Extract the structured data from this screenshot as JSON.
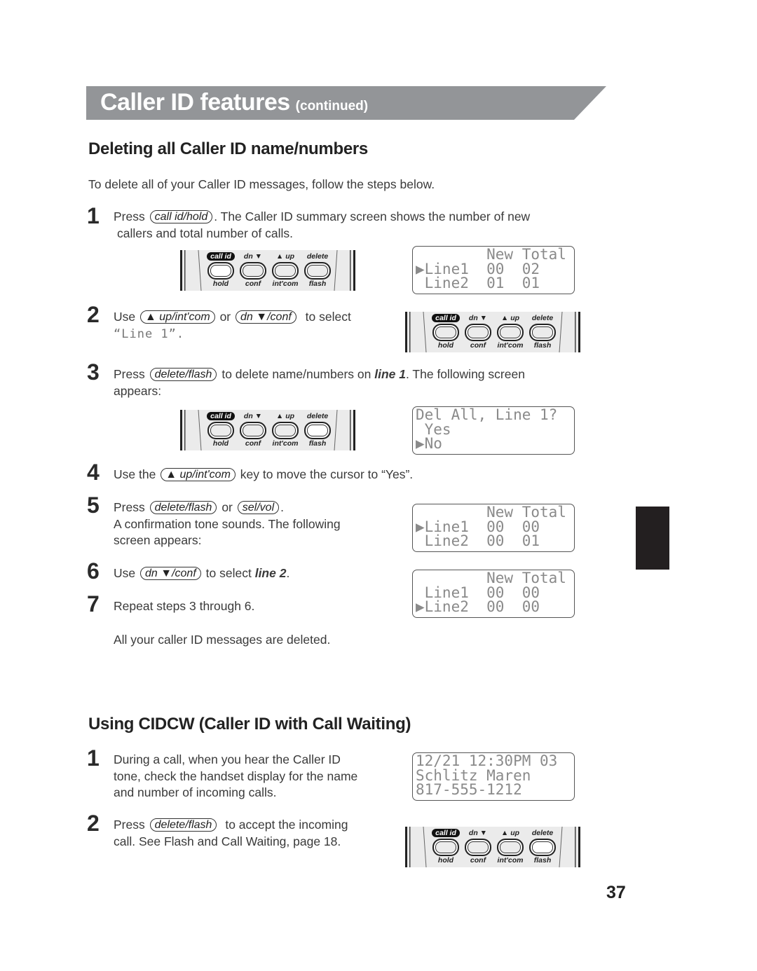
{
  "banner": {
    "title": "Caller ID features",
    "subtitle": "(continued)",
    "color": "#939598"
  },
  "section1": {
    "heading": "Deleting all Caller ID name/numbers",
    "intro": "To delete all of your Caller ID messages, follow the steps below.",
    "steps": [
      {
        "num": "1",
        "pre": "Press",
        "key1": "call id/hold",
        "post": ". The Caller ID summary screen shows the number of new",
        "line2": "callers and total number of calls."
      },
      {
        "num": "2",
        "pre": "Use",
        "key1": "▲ up/int'com",
        "mid": "or",
        "key2": "dn ▼/conf",
        "post": "to select",
        "line2_lcd": "“Line 1”."
      },
      {
        "num": "3",
        "pre": "Press",
        "key1": "delete/flash",
        "post_a": "to delete name/numbers on",
        "post_bold": "line 1",
        "post_b": ". The following screen",
        "line2": "appears:"
      },
      {
        "num": "4",
        "pre": "Use the",
        "key1": "▲ up/int'com",
        "post": "key to move the cursor to “Yes”."
      },
      {
        "num": "5",
        "pre": "Press",
        "key1": "delete/flash",
        "mid": "or",
        "key2": "sel/vol",
        "post": ".",
        "line2": "A confirmation tone sounds. The following",
        "line3": "screen appears:"
      },
      {
        "num": "6",
        "pre": "Use",
        "key1": "dn ▼/conf",
        "post_a": "to select",
        "post_bold": "line 2",
        "post_b": "."
      },
      {
        "num": "7",
        "text": "Repeat steps 3 through 6."
      }
    ],
    "closing": "All your caller ID messages are deleted."
  },
  "section2": {
    "heading": "Using CIDCW (Caller ID with Call Waiting)",
    "steps": [
      {
        "num": "1",
        "line1": "During a call, when you hear the Caller ID",
        "line2": "tone, check the handset display for the name",
        "line3": "and number of incoming calls."
      },
      {
        "num": "2",
        "pre": "Press",
        "key1": "delete/flash",
        "post": "to accept the incoming",
        "line2": "call. See Flash and Call Waiting, page 18."
      }
    ]
  },
  "screens": {
    "summary1": [
      "        New Total",
      "▶Line1  00  02",
      " Line2  01  01"
    ],
    "delete_prompt": [
      "Del All, Line 1?",
      " Yes",
      "▶No"
    ],
    "summary2": [
      "        New Total",
      "▶Line1  00  00",
      " Line2  00  01"
    ],
    "summary3": [
      "        New Total",
      " Line1  00  00",
      "▶Line2  00  00"
    ],
    "cidcw": [
      "12/21 12:30PM 03",
      "Schlitz Maren",
      "817-555-1212"
    ]
  },
  "keypad": {
    "keys": [
      {
        "top": "call id",
        "bottom": "hold"
      },
      {
        "top": "dn ▼",
        "bottom": "conf"
      },
      {
        "top": "▲ up",
        "bottom": "int'com"
      },
      {
        "top": "delete",
        "bottom": "flash"
      }
    ]
  },
  "page_number": "37"
}
